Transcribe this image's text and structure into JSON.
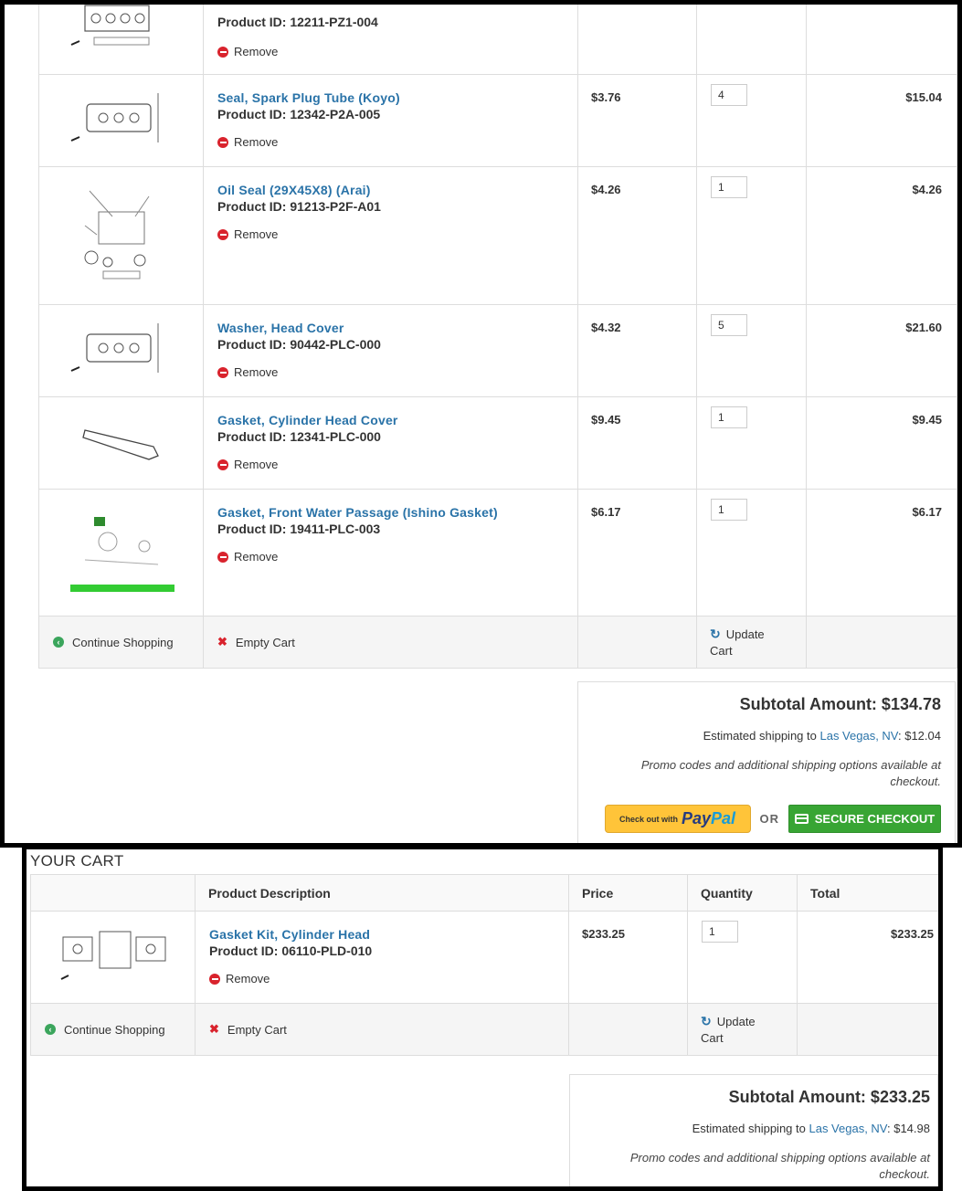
{
  "top_cart": {
    "items": [
      {
        "name": "",
        "product_id": "Product ID: 12211-PZ1-004",
        "price": "",
        "qty": "",
        "total": "",
        "img": "engine-head-diagram"
      },
      {
        "name": "Seal, Spark Plug Tube (Koyo)",
        "product_id": "Product ID: 12342-P2A-005",
        "price": "$3.76",
        "qty": "4",
        "total": "$15.04",
        "img": "head-cover-diagram"
      },
      {
        "name": "Oil Seal (29X45X8) (Arai)",
        "product_id": "Product ID: 91213-P2F-A01",
        "price": "$4.26",
        "qty": "1",
        "total": "$4.26",
        "img": "exploded-engine-diagram"
      },
      {
        "name": "Washer, Head Cover",
        "product_id": "Product ID: 90442-PLC-000",
        "price": "$4.32",
        "qty": "5",
        "total": "$21.60",
        "img": "head-cover-diagram"
      },
      {
        "name": "Gasket, Cylinder Head Cover",
        "product_id": "Product ID: 12341-PLC-000",
        "price": "$9.45",
        "qty": "1",
        "total": "$9.45",
        "img": "gasket-diagram"
      },
      {
        "name": "Gasket, Front Water Passage (Ishino Gasket)",
        "product_id": "Product ID: 19411-PLC-003",
        "price": "$6.17",
        "qty": "1",
        "total": "$6.17",
        "img": "water-passage-diagram"
      }
    ],
    "remove_label": "Remove",
    "continue_label": "Continue Shopping",
    "empty_label": "Empty Cart",
    "update_label_1": "Update",
    "update_label_2": "Cart",
    "summary": {
      "subtotal": "Subtotal Amount: $134.78",
      "shipping_prefix": "Estimated shipping to",
      "location": "Las Vegas, NV",
      "shipping_suffix": ": $12.04",
      "promo_1": "Promo codes and additional shipping options available at",
      "promo_2": "checkout.",
      "paypal_small": "Check out with",
      "paypal_pay": "Pay",
      "paypal_pal": "Pal",
      "or": "OR",
      "secure": "SECURE CHECKOUT"
    }
  },
  "bottom_cart": {
    "heading": "YOUR CART",
    "headers": {
      "desc": "Product Description",
      "price": "Price",
      "qty": "Quantity",
      "total": "Total"
    },
    "items": [
      {
        "name": "Gasket Kit, Cylinder Head",
        "product_id": "Product ID: 06110-PLD-010",
        "price": "$233.25",
        "qty": "1",
        "total": "$233.25",
        "img": "gasket-kit-diagram"
      }
    ],
    "remove_label": "Remove",
    "continue_label": "Continue Shopping",
    "empty_label": "Empty Cart",
    "update_label_1": "Update",
    "update_label_2": "Cart",
    "summary": {
      "subtotal": "Subtotal Amount: $233.25",
      "shipping_prefix": "Estimated shipping to",
      "location": "Las Vegas, NV",
      "shipping_suffix": ": $14.98",
      "promo_1": "Promo codes and additional shipping options available at",
      "promo_2": "checkout."
    }
  }
}
